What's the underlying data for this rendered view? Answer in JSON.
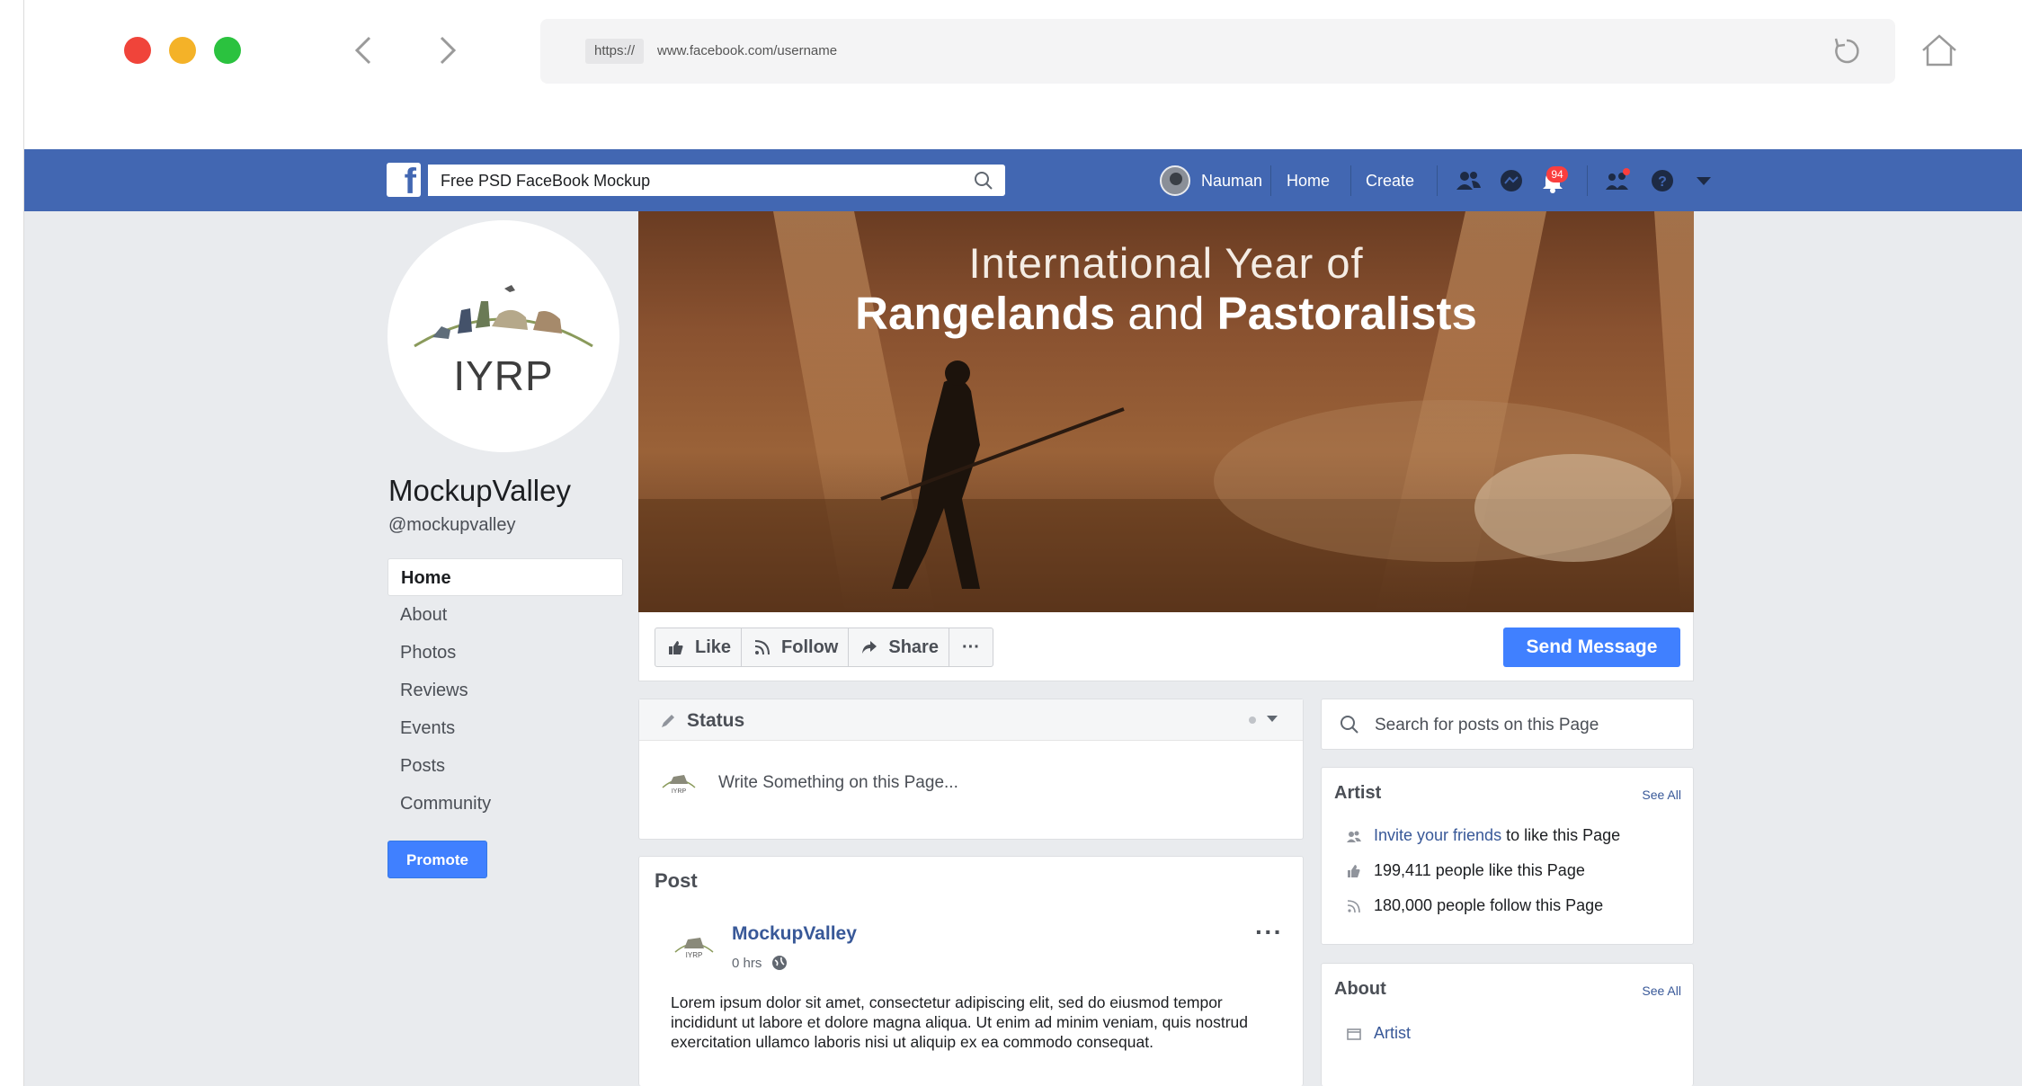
{
  "browser": {
    "url_protocol": "https://",
    "url": "www.facebook.com/username"
  },
  "topbar": {
    "logo": "f",
    "search_value": "Free PSD FaceBook Mockup",
    "user_name": "Nauman",
    "nav_home": "Home",
    "nav_create": "Create",
    "notification_count": "94",
    "color": "#4267b2"
  },
  "page": {
    "logo_text": "IYRP",
    "name": "MockupValley",
    "handle": "@mockupvalley",
    "nav": [
      "Home",
      "About",
      "Photos",
      "Reviews",
      "Events",
      "Posts",
      "Community"
    ],
    "promote_label": "Promote"
  },
  "cover": {
    "line1": "International Year of",
    "line2_a": "Rangelands",
    "line2_b": "and",
    "line2_c": "Pastoralists"
  },
  "actions": {
    "like": "Like",
    "follow": "Follow",
    "share": "Share",
    "more": "···",
    "send_message": "Send Message"
  },
  "status": {
    "label": "Status",
    "placeholder": "Write Something on this Page..."
  },
  "post": {
    "section_title": "Post",
    "author": "MockupValley",
    "time": "0 hrs",
    "more": "···",
    "body": "Lorem ipsum dolor sit amet, consectetur adipiscing elit, sed do eiusmod tempor incididunt ut labore et dolore magna aliqua. Ut enim ad minim veniam, quis nostrud exercitation ullamco laboris nisi ut aliquip ex ea commodo consequat."
  },
  "sidebar": {
    "search_placeholder": "Search for posts on this Page",
    "artist": {
      "title": "Artist",
      "see_all": "See All",
      "invite_link": "Invite your friends",
      "invite_rest": " to like this Page",
      "likes": "199,411 people like this Page",
      "follows": "180,000 people follow this Page"
    },
    "about": {
      "title": "About",
      "see_all": "See All",
      "category": "Artist"
    }
  },
  "colors": {
    "accent": "#4080ff",
    "link": "#385898",
    "background": "#e9ebee"
  }
}
